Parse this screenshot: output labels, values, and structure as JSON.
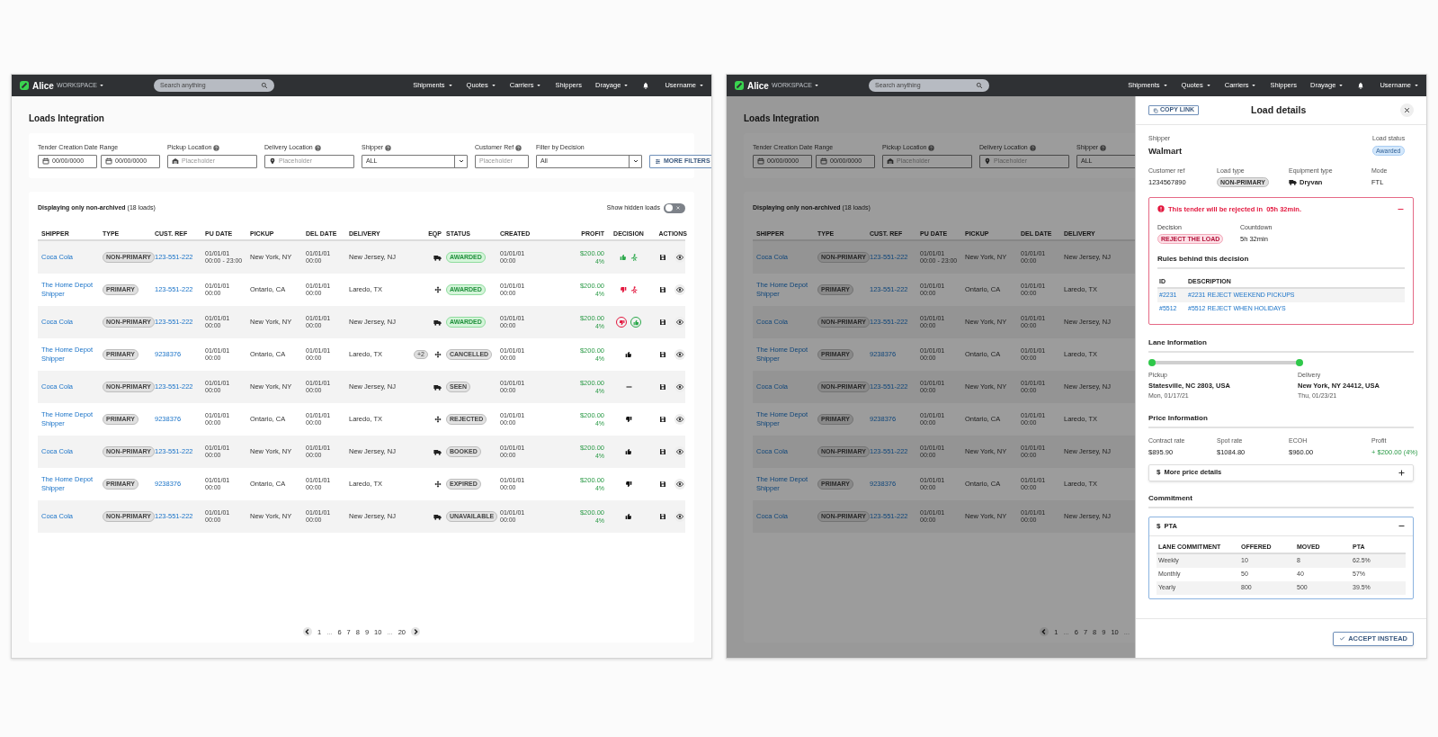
{
  "screens": [
    {
      "kind": "list",
      "nav": {
        "logo": "Alice",
        "workspace": "WORKSPACE",
        "search_placeholder": "Search anything",
        "menu": [
          {
            "label": "Shipments",
            "dropdown": true
          },
          {
            "label": "Quotes",
            "dropdown": true
          },
          {
            "label": "Carriers",
            "dropdown": true
          },
          {
            "label": "Shippers",
            "dropdown": false
          },
          {
            "label": "Drayage",
            "dropdown": true
          }
        ],
        "user": "Username"
      },
      "page_title": "Loads Integration",
      "filters": [
        {
          "kind": "dates",
          "label": "Tender Creation Date Range",
          "help": false,
          "values": [
            "00/00/0000",
            "00/00/0000"
          ]
        },
        {
          "kind": "pickup_location",
          "label": "Pickup Location",
          "help": true,
          "placeholder": "Placeholder"
        },
        {
          "kind": "delivery_location",
          "label": "Delivery Location",
          "help": true,
          "placeholder": "Placeholder"
        },
        {
          "kind": "select",
          "label": "Shipper",
          "help": true,
          "value": "ALL"
        },
        {
          "kind": "text",
          "label": "Customer Ref",
          "help": true,
          "placeholder": "Placeholder"
        },
        {
          "kind": "select",
          "label": "Filter by Decision",
          "help": false,
          "value": "All"
        }
      ],
      "more_filters": "MORE FILTERS",
      "display_note": "**Displaying only non-archived** (18 loads)",
      "hidden_toggle": {
        "label": "Show hidden loads",
        "on": false
      },
      "table": {
        "columns": [
          "SHIPPER",
          "TYPE",
          "CUST. REF",
          "PU DATE",
          "PICKUP",
          "DEL DATE",
          "DELIVERY",
          "EQP",
          "STATUS",
          "CREATED",
          "PROFIT",
          "DECISION",
          "ACTIONS"
        ],
        "rows": [
          {
            "shipper": "Coca Cola",
            "type": "NON-PRIMARY",
            "cust_ref": "123-551-222",
            "pu_date": "01/01/01",
            "pu_time": "00:00 - 23:00",
            "pickup": "New York, NY",
            "del_date": "01/01/01",
            "del_time": "00:00",
            "delivery": "New Jersey, NJ",
            "equipment": {
              "kind": "truck"
            },
            "status": {
              "label": "AWARDED",
              "kind": "success"
            },
            "created_date": "01/01/01",
            "created_time": "00:00",
            "profit": "$200.00",
            "profit_pct": "4%",
            "decision": {
              "kind": "auto_accept"
            }
          },
          {
            "shipper": "The Home Depot Shipper",
            "type": "PRIMARY",
            "cust_ref": "123-551-222",
            "pu_date": "01/01/01",
            "pu_time": "00:00",
            "pickup": "Ontario, CA",
            "del_date": "01/01/01",
            "del_time": "00:00",
            "delivery": "Laredo, TX",
            "equipment": {
              "kind": "flatbed"
            },
            "status": {
              "label": "AWARDED",
              "kind": "success"
            },
            "created_date": "01/01/01",
            "created_time": "00:00",
            "profit": "$200.00",
            "profit_pct": "4%",
            "decision": {
              "kind": "auto_reject"
            }
          },
          {
            "shipper": "Coca Cola",
            "type": "NON-PRIMARY",
            "cust_ref": "123-551-222",
            "pu_date": "01/01/01",
            "pu_time": "00:00",
            "pickup": "New York, NY",
            "del_date": "01/01/01",
            "del_time": "00:00",
            "delivery": "New Jersey, NJ",
            "equipment": {
              "kind": "truck"
            },
            "status": {
              "label": "AWARDED",
              "kind": "success"
            },
            "created_date": "01/01/01",
            "created_time": "00:00",
            "profit": "$200.00",
            "profit_pct": "4%",
            "decision": {
              "kind": "pending"
            }
          },
          {
            "shipper": "The Home Depot Shipper",
            "type": "PRIMARY",
            "cust_ref": "9238376",
            "pu_date": "01/01/01",
            "pu_time": "00:00",
            "pickup": "Ontario, CA",
            "del_date": "01/01/01",
            "del_time": "00:00",
            "delivery": "Laredo, TX",
            "extra": "+2",
            "equipment": {
              "kind": "flatbed"
            },
            "status": {
              "label": "CANCELLED",
              "kind": "neutral"
            },
            "created_date": "01/01/01",
            "created_time": "00:00",
            "profit": "$200.00",
            "profit_pct": "4%",
            "decision": {
              "kind": "accepted"
            }
          },
          {
            "shipper": "Coca Cola",
            "type": "NON-PRIMARY",
            "cust_ref": "123-551-222",
            "pu_date": "01/01/01",
            "pu_time": "00:00",
            "pickup": "New York, NY",
            "del_date": "01/01/01",
            "del_time": "00:00",
            "delivery": "New Jersey, NJ",
            "equipment": {
              "kind": "truck"
            },
            "status": {
              "label": "SEEN",
              "kind": "neutral"
            },
            "created_date": "01/01/01",
            "created_time": "00:00",
            "profit": "$200.00",
            "profit_pct": "4%",
            "decision": {
              "kind": "none"
            }
          },
          {
            "shipper": "The Home Depot Shipper",
            "type": "PRIMARY",
            "cust_ref": "9238376",
            "pu_date": "01/01/01",
            "pu_time": "00:00",
            "pickup": "Ontario, CA",
            "del_date": "01/01/01",
            "del_time": "00:00",
            "delivery": "Laredo, TX",
            "equipment": {
              "kind": "flatbed"
            },
            "status": {
              "label": "REJECTED",
              "kind": "neutral"
            },
            "created_date": "01/01/01",
            "created_time": "00:00",
            "profit": "$200.00",
            "profit_pct": "4%",
            "decision": {
              "kind": "rejected"
            }
          },
          {
            "shipper": "Coca Cola",
            "type": "NON-PRIMARY",
            "cust_ref": "123-551-222",
            "pu_date": "01/01/01",
            "pu_time": "00:00",
            "pickup": "New York, NY",
            "del_date": "01/01/01",
            "del_time": "00:00",
            "delivery": "New Jersey, NJ",
            "equipment": {
              "kind": "truck"
            },
            "status": {
              "label": "BOOKED",
              "kind": "neutral"
            },
            "created_date": "01/01/01",
            "created_time": "00:00",
            "profit": "$200.00",
            "profit_pct": "4%",
            "decision": {
              "kind": "accepted"
            }
          },
          {
            "shipper": "The Home Depot Shipper",
            "type": "PRIMARY",
            "cust_ref": "9238376",
            "pu_date": "01/01/01",
            "pu_time": "00:00",
            "pickup": "Ontario, CA",
            "del_date": "01/01/01",
            "del_time": "00:00",
            "delivery": "Laredo, TX",
            "equipment": {
              "kind": "flatbed"
            },
            "status": {
              "label": "EXPIRED",
              "kind": "neutral"
            },
            "created_date": "01/01/01",
            "created_time": "00:00",
            "profit": "$200.00",
            "profit_pct": "4%",
            "decision": {
              "kind": "rejected"
            }
          },
          {
            "shipper": "Coca Cola",
            "type": "NON-PRIMARY",
            "cust_ref": "123-551-222",
            "pu_date": "01/01/01",
            "pu_time": "00:00",
            "pickup": "New York, NY",
            "del_date": "01/01/01",
            "del_time": "00:00",
            "delivery": "New Jersey, NJ",
            "equipment": {
              "kind": "truck"
            },
            "status": {
              "label": "UNAVAILABLE",
              "kind": "neutral"
            },
            "created_date": "01/01/01",
            "created_time": "00:00",
            "profit": "$200.00",
            "profit_pct": "4%",
            "decision": {
              "kind": "accepted"
            }
          }
        ]
      },
      "pagination": {
        "pages": [
          {
            "label": "1",
            "kind": "page"
          },
          {
            "label": "...",
            "kind": "gap"
          },
          {
            "label": "6",
            "kind": "page"
          },
          {
            "label": "7",
            "kind": "page"
          },
          {
            "label": "8",
            "kind": "page"
          },
          {
            "label": "9",
            "kind": "page"
          },
          {
            "label": "10",
            "kind": "page"
          },
          {
            "label": "...",
            "kind": "gap"
          },
          {
            "label": "20",
            "kind": "page"
          }
        ],
        "next": true
      }
    },
    {
      "kind": "detail",
      "nav": {
        "logo": "Alice",
        "workspace": "WORKSPACE",
        "search_placeholder": "Search anything",
        "menu": [
          {
            "label": "Shipments",
            "dropdown": true
          },
          {
            "label": "Quotes",
            "dropdown": true
          },
          {
            "label": "Carriers",
            "dropdown": true
          },
          {
            "label": "Shippers",
            "dropdown": false
          },
          {
            "label": "Drayage",
            "dropdown": true
          }
        ],
        "user": "Username"
      },
      "page_title": "Loads Integration",
      "filters": [
        {
          "kind": "dates",
          "label": "Tender Creation Date Range",
          "help": false,
          "values": [
            "00/00/0000",
            "00/00/0000"
          ]
        },
        {
          "kind": "pickup_location",
          "label": "Pickup Location",
          "help": true,
          "placeholder": "Placeholder"
        },
        {
          "kind": "delivery_location",
          "label": "Delivery Location",
          "help": true,
          "placeholder": "Placeholder"
        },
        {
          "kind": "select",
          "label": "Shipper",
          "help": true,
          "value": "ALL"
        }
      ],
      "display_note": "**Displaying only non-archived** (18 loads)",
      "table": {
        "columns": [
          "SHIPPER",
          "TYPE",
          "CUST. REF",
          "PU DATE",
          "PICKUP",
          "DEL DATE",
          "DELIVERY"
        ],
        "rows": [
          {
            "shipper": "Coca Cola",
            "type": "NON-PRIMARY",
            "cust_ref": "123-551-222",
            "pu_date": "01/01/01",
            "pu_time": "00:00 - 23:00",
            "pickup": "New York, NY",
            "del_date": "01/01/01",
            "del_time": "00:00",
            "delivery": "New Jersey, NJ"
          },
          {
            "shipper": "The Home Depot Shipper",
            "type": "PRIMARY",
            "cust_ref": "123-551-222",
            "pu_date": "01/01/01",
            "pu_time": "00:00",
            "pickup": "Ontario, CA",
            "del_date": "01/01/01",
            "del_time": "00:00",
            "delivery": "Laredo, TX"
          },
          {
            "shipper": "Coca Cola",
            "type": "NON-PRIMARY",
            "cust_ref": "123-551-222",
            "pu_date": "01/01/01",
            "pu_time": "00:00",
            "pickup": "New York, NY",
            "del_date": "01/01/01",
            "del_time": "00:00",
            "delivery": "New Jersey, NJ"
          },
          {
            "shipper": "The Home Depot Shipper",
            "type": "PRIMARY",
            "cust_ref": "9238376",
            "pu_date": "01/01/01",
            "pu_time": "00:00",
            "pickup": "Ontario, CA",
            "del_date": "01/01/01",
            "del_time": "00:00",
            "delivery": "Laredo, TX"
          },
          {
            "shipper": "Coca Cola",
            "type": "NON-PRIMARY",
            "cust_ref": "123-551-222",
            "pu_date": "01/01/01",
            "pu_time": "00:00",
            "pickup": "New York, NY",
            "del_date": "01/01/01",
            "del_time": "00:00",
            "delivery": "New Jersey, NJ"
          },
          {
            "shipper": "The Home Depot Shipper",
            "type": "PRIMARY",
            "cust_ref": "9238376",
            "pu_date": "01/01/01",
            "pu_time": "00:00",
            "pickup": "Ontario, CA",
            "del_date": "01/01/01",
            "del_time": "00:00",
            "delivery": "Laredo, TX"
          },
          {
            "shipper": "Coca Cola",
            "type": "NON-PRIMARY",
            "cust_ref": "123-551-222",
            "pu_date": "01/01/01",
            "pu_time": "00:00",
            "pickup": "New York, NY",
            "del_date": "01/01/01",
            "del_time": "00:00",
            "delivery": "New Jersey, NJ"
          },
          {
            "shipper": "The Home Depot Shipper",
            "type": "PRIMARY",
            "cust_ref": "9238376",
            "pu_date": "01/01/01",
            "pu_time": "00:00",
            "pickup": "Ontario, CA",
            "del_date": "01/01/01",
            "del_time": "00:00",
            "delivery": "Laredo, TX"
          },
          {
            "shipper": "Coca Cola",
            "type": "NON-PRIMARY",
            "cust_ref": "123-551-222",
            "pu_date": "01/01/01",
            "pu_time": "00:00",
            "pickup": "New York, NY",
            "del_date": "01/01/01",
            "del_time": "00:00",
            "delivery": "New Jersey, NJ"
          }
        ]
      },
      "pagination": {
        "pages": [
          {
            "label": "1",
            "kind": "page"
          },
          {
            "label": "...",
            "kind": "gap"
          },
          {
            "label": "6",
            "kind": "page"
          },
          {
            "label": "7",
            "kind": "page"
          },
          {
            "label": "8",
            "kind": "page"
          },
          {
            "label": "9",
            "kind": "page"
          },
          {
            "label": "10",
            "kind": "page"
          },
          {
            "label": "...",
            "kind": "gap"
          }
        ],
        "next": false
      },
      "drawer": {
        "copy_link": "COPY LINK",
        "title": "Load details",
        "shipper_label": "Shipper",
        "shipper": "Walmart",
        "status_label": "Load status",
        "status": "Awarded",
        "fields": [
          {
            "label": "Customer ref",
            "value": "1234567890",
            "kind": "text"
          },
          {
            "label": "Load type",
            "value": "NON-PRIMARY",
            "kind": "badge"
          },
          {
            "label": "Equipment type",
            "value": "Dryvan",
            "kind": "equipment"
          },
          {
            "label": "Mode",
            "value": "FTL",
            "kind": "text"
          }
        ],
        "alert": {
          "message": "This tender will be rejected in  05h 32min.",
          "expanded": true,
          "decision_label": "Decision",
          "decision": "REJECT THE LOAD",
          "countdown_label": "Countdown",
          "countdown": "5h 32min",
          "rules_title": "Rules behind this decision",
          "columns": [
            "ID",
            "DESCRIPTION"
          ],
          "rows": [
            [
              "#2231",
              "#2231 REJECT WEEKEND PICKUPS"
            ],
            [
              "#5512",
              "#5512 REJECT WHEN HOLIDAYS"
            ]
          ]
        },
        "lane": {
          "title": "Lane Information",
          "stops": [
            {
              "label": "Pickup",
              "place": "Statesville, NC 2803, USA",
              "date": "Mon, 01/17/21"
            },
            {
              "label": "Delivery",
              "place": "New York, NY 24412, USA",
              "date": "Thu, 01/23/21"
            }
          ]
        },
        "price": {
          "title": "Price Information",
          "items": [
            {
              "label": "Contract rate",
              "value": "$895.90",
              "kind": "plain"
            },
            {
              "label": "Spot rate",
              "value": "$1084.80",
              "kind": "plain"
            },
            {
              "label": "ECOH",
              "value": "$960.00",
              "kind": "plain"
            },
            {
              "label": "Profit",
              "value": "+ $200.00 (4%)",
              "kind": "profit"
            }
          ]
        },
        "price_details": {
          "symbol": "$",
          "label": "More price details",
          "expanded": false
        },
        "commitment": {
          "title": "Commitment",
          "symbol": "$",
          "label": "PTA",
          "expanded": true,
          "columns": [
            "LANE COMMITMENT",
            "OFFERED",
            "MOVED",
            "PTA"
          ],
          "rows": [
            [
              "Weekly",
              "10",
              "8",
              "62.5%"
            ],
            [
              "Monthly",
              "50",
              "40",
              "57%"
            ],
            [
              "Yearly",
              "800",
              "500",
              "39.5%"
            ]
          ]
        },
        "accept_button": "ACCEPT INSTEAD"
      }
    }
  ]
}
